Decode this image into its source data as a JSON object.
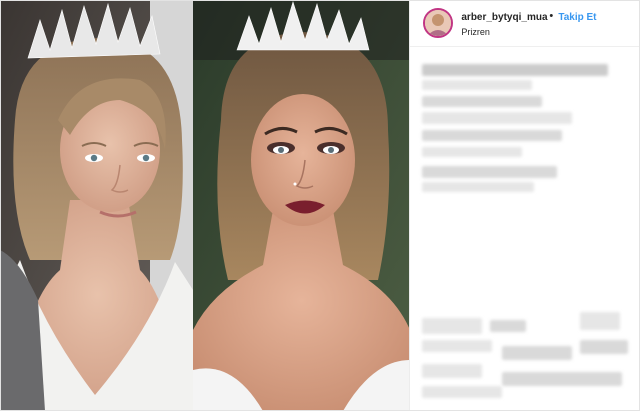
{
  "post": {
    "username": "arber_bytyqi_mua",
    "separator": "•",
    "follow_label": "Takip Et",
    "location": "Prizren"
  },
  "colors": {
    "accent": "#3897f0",
    "text": "#262626"
  }
}
